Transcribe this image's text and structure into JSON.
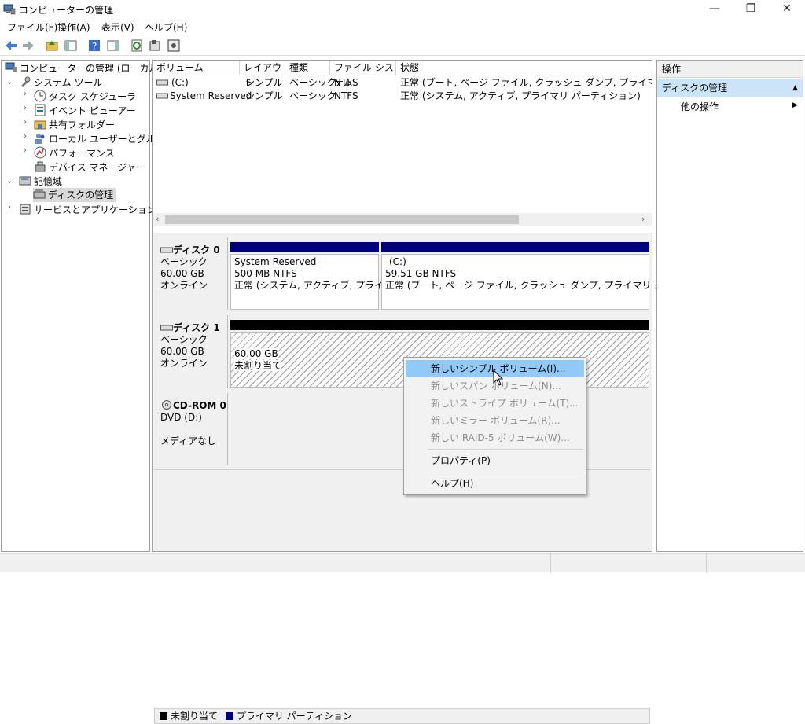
{
  "window": {
    "title": "コンピューターの管理"
  },
  "window_controls": {
    "minimize": "—",
    "maximize": "❐",
    "close": "✕"
  },
  "menu": [
    "ファイル(F)",
    "操作(A)",
    "表示(V)",
    "ヘルプ(H)"
  ],
  "tree": {
    "root": "コンピューターの管理 (ローカル)",
    "system_tools": "システム ツール",
    "task_scheduler": "タスク スケジューラ",
    "event_viewer": "イベント ビューアー",
    "shared_folders": "共有フォルダー",
    "local_users": "ローカル ユーザーとグループ",
    "performance": "パフォーマンス",
    "device_manager": "デバイス マネージャー",
    "storage": "記憶域",
    "disk_management": "ディスクの管理",
    "services_apps": "サービスとアプリケーション"
  },
  "volume_list": {
    "columns": [
      "ボリューム",
      "レイアウト",
      "種類",
      "ファイル システム",
      "状態"
    ],
    "rows": [
      {
        "volume": "(C:)",
        "layout": "シンプル",
        "type": "ベーシック",
        "fs": "NTFS",
        "status": "正常 (ブート, ページ ファイル, クラッシュ ダンプ, プライマリ パーティション)"
      },
      {
        "volume": "System Reserved",
        "layout": "シンプル",
        "type": "ベーシック",
        "fs": "NTFS",
        "status": "正常 (システム, アクティブ, プライマリ パーティション)"
      }
    ]
  },
  "disks": {
    "disk0": {
      "name": "ディスク 0",
      "type": "ベーシック",
      "size": "60.00 GB",
      "state": "オンライン",
      "p1": {
        "name": "System Reserved",
        "size": "500 MB NTFS",
        "status": "正常 (システム, アクティブ, プライマリ パ"
      },
      "p2": {
        "name": "(C:)",
        "size": "59.51 GB NTFS",
        "status": "正常 (ブート, ページ ファイル, クラッシュ ダンプ, プライマリ パーティション)"
      }
    },
    "disk1": {
      "name": "ディスク 1",
      "type": "ベーシック",
      "size": "60.00 GB",
      "state": "オンライン",
      "p1": {
        "size": "60.00 GB",
        "status": "未割り当て"
      }
    },
    "cdrom0": {
      "name": "CD-ROM 0",
      "drive": "DVD (D:)",
      "state": "メディアなし"
    }
  },
  "legend": {
    "unallocated": "未割り当て",
    "primary": "プライマリ パーティション"
  },
  "colors": {
    "primary_bar": "#00007f",
    "unallocated_bar": "#000000",
    "selection": "#cce4f7",
    "menu_hover": "#91c9f7"
  },
  "actions": {
    "header": "操作",
    "selected": "ディスクの管理",
    "more": "他の操作"
  },
  "context_menu": {
    "new_simple": "新しいシンプル ボリューム(I)...",
    "new_spanned": "新しいスパン ボリューム(N)...",
    "new_striped": "新しいストライプ ボリューム(T)...",
    "new_mirror": "新しいミラー ボリューム(R)...",
    "new_raid5": "新しい RAID-5 ボリューム(W)...",
    "properties": "プロパティ(P)",
    "help": "ヘルプ(H)"
  }
}
